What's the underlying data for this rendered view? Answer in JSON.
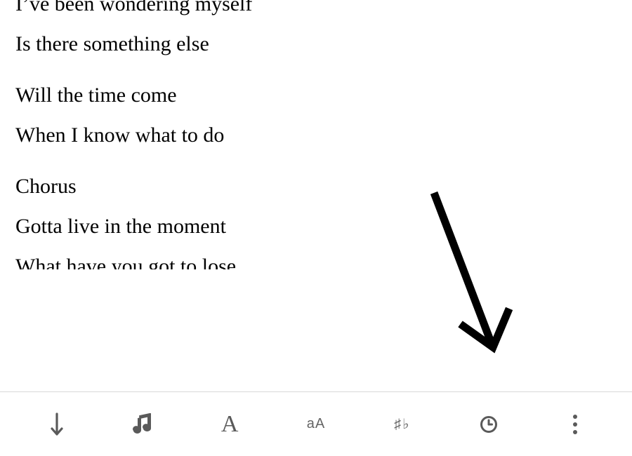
{
  "lyrics": {
    "block1": {
      "lines": [
        "I’ve been wondering myself",
        "Is there something else"
      ]
    },
    "block2": {
      "lines": [
        "Will the time come",
        "When I know what to do"
      ]
    },
    "block3": {
      "lines": [
        "Chorus",
        "Gotta live in the moment",
        "What have you got to lose"
      ]
    }
  },
  "toolbar": {
    "scroll_icon": "scroll-down",
    "music_icon": "music-note",
    "font_icon_label": "A",
    "case_icon_label": "aA",
    "transpose_icon_label": "♯♭",
    "clock_icon": "clock",
    "more_icon": "more-vertical"
  },
  "colors": {
    "text": "#000000",
    "icon": "#5a5a5a",
    "divider": "#d8d8d8",
    "background": "#ffffff"
  }
}
